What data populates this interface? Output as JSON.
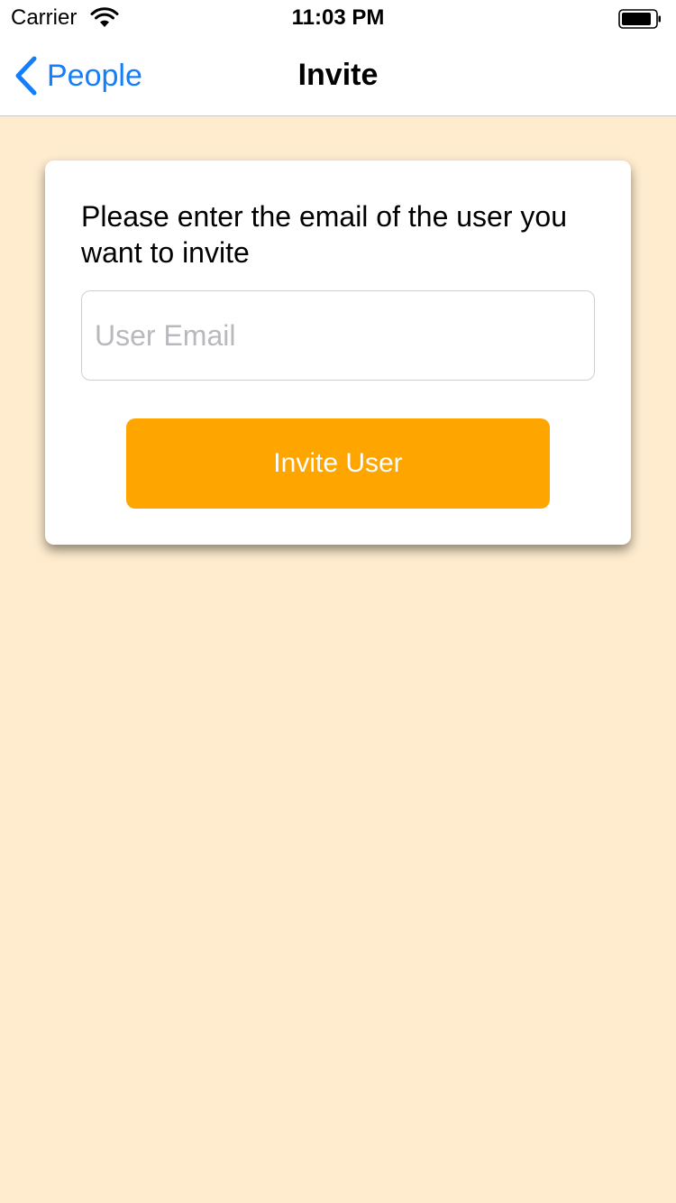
{
  "status_bar": {
    "carrier": "Carrier",
    "time": "11:03 PM",
    "wifi_icon": "wifi-icon",
    "battery_icon": "battery-icon"
  },
  "nav": {
    "back_label": "People",
    "back_icon": "chevron-left-icon",
    "title": "Invite"
  },
  "card": {
    "instructions": "Please enter the email of the user you want to invite",
    "email_placeholder": "User Email",
    "email_value": "",
    "invite_label": "Invite User"
  },
  "colors": {
    "background": "#ffecce",
    "accent": "#147efb",
    "button": "#ffa500"
  }
}
